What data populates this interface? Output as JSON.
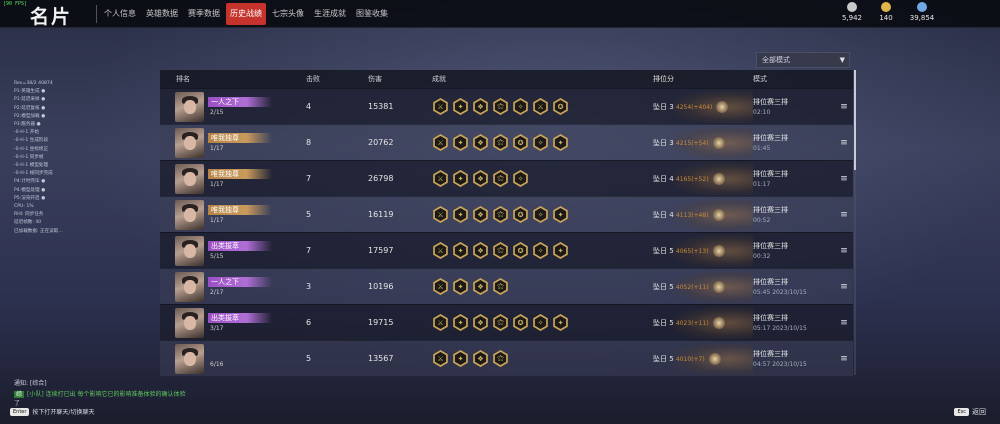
{
  "app": {
    "title": "名片",
    "fps_label": "[90 FPS]"
  },
  "tabs": [
    {
      "label": "个人信息",
      "active": false
    },
    {
      "label": "英雄数据",
      "active": false
    },
    {
      "label": "赛季数据",
      "active": false
    },
    {
      "label": "历史战绩",
      "active": true
    },
    {
      "label": "七宗头像",
      "active": false
    },
    {
      "label": "生涯成就",
      "active": false
    },
    {
      "label": "图鉴收集",
      "active": false
    }
  ],
  "currencies": [
    {
      "icon": "coin-stack-icon",
      "value": "5,942",
      "color": "#c9c9c9"
    },
    {
      "icon": "gold-ingot-icon",
      "value": "140",
      "color": "#e0b54a"
    },
    {
      "icon": "diamond-icon",
      "value": "39,854",
      "color": "#6fa8e6"
    }
  ],
  "mode_dropdown": {
    "selected": "全部模式"
  },
  "table": {
    "headers": {
      "name": "排名",
      "kills": "击败",
      "damage": "伤害",
      "achievements": "成就",
      "rank": "排位分",
      "mode": "模式"
    },
    "rows": [
      {
        "title": "一人之下",
        "title_style": "purple",
        "placement": "2/15",
        "kills": "4",
        "damage": "15381",
        "icons": [
          "⚔",
          "✦",
          "❖",
          "⚝",
          "✧",
          "⚔",
          "✪"
        ],
        "rank": "坠日 3",
        "rank_delta": "4254(+404)",
        "mode": "排位赛三排",
        "time": "02:10",
        "style": "dark"
      },
      {
        "title": "唯我独尊",
        "title_style": "gold",
        "placement": "1/17",
        "kills": "8",
        "damage": "20762",
        "icons": [
          "⚔",
          "✦",
          "❖",
          "⚝",
          "✪",
          "✧",
          "✦"
        ],
        "rank": "坠日 3",
        "rank_delta": "4215(+54)",
        "mode": "排位赛三排",
        "time": "01:45",
        "style": "light"
      },
      {
        "title": "唯我独尊",
        "title_style": "gold",
        "placement": "1/17",
        "kills": "7",
        "damage": "26798",
        "icons": [
          "⚔",
          "✦",
          "❖",
          "⚝",
          "✧"
        ],
        "rank": "坠日 4",
        "rank_delta": "4165(+52)",
        "mode": "排位赛三排",
        "time": "01:17",
        "style": "dark"
      },
      {
        "title": "唯我独尊",
        "title_style": "gold",
        "placement": "1/17",
        "kills": "5",
        "damage": "16119",
        "icons": [
          "⚔",
          "✦",
          "❖",
          "⚝",
          "✪",
          "✧",
          "✦"
        ],
        "rank": "坠日 4",
        "rank_delta": "4113(+48)",
        "mode": "排位赛三排",
        "time": "00:52",
        "style": "light"
      },
      {
        "title": "出类拔萃",
        "title_style": "purple",
        "placement": "5/15",
        "kills": "7",
        "damage": "17597",
        "icons": [
          "⚔",
          "✦",
          "❖",
          "⚝",
          "✪",
          "✧",
          "✦"
        ],
        "rank": "坠日 5",
        "rank_delta": "4065(+13)",
        "mode": "排位赛三排",
        "time": "00:32",
        "style": "dark"
      },
      {
        "title": "一人之下",
        "title_style": "purple",
        "placement": "2/17",
        "kills": "3",
        "damage": "10196",
        "icons": [
          "⚔",
          "✦",
          "❖",
          "⚝"
        ],
        "rank": "坠日 5",
        "rank_delta": "4052(+11)",
        "mode": "排位赛三排",
        "time": "05:45  2023/10/15",
        "style": "light"
      },
      {
        "title": "出类拔萃",
        "title_style": "purple",
        "placement": "3/17",
        "kills": "6",
        "damage": "19715",
        "icons": [
          "⚔",
          "✦",
          "❖",
          "⚝",
          "✪",
          "✧",
          "✦"
        ],
        "rank": "坠日 5",
        "rank_delta": "4023(+11)",
        "mode": "排位赛三排",
        "time": "05:17  2023/10/15",
        "style": "dark"
      },
      {
        "title": "",
        "title_style": "empty",
        "placement": "6/16",
        "kills": "5",
        "damage": "13567",
        "icons": [
          "⚔",
          "✦",
          "❖",
          "⚝"
        ],
        "rank": "坠日 5",
        "rank_delta": "4010(+7)",
        "mode": "排位赛三排",
        "time": "04:57  2023/10/15",
        "style": "light"
      }
    ]
  },
  "log_lines": [
    "Rev=38/2 40874",
    "P1:英雄生成 ●",
    "P1:延迟采样 ●",
    "P2:延迟复核 ●",
    "P2:模型加载 ●",
    "P3:服务器 ●",
    "-0-H-1 开始",
    "-0-H-1 生成阶段",
    "-0-H-1 坐标修正",
    "-0-H-1 同步帧",
    "-0-H-1 模型处理",
    "-0-H-1 帧同步完成",
    "P4:计时完毕 ●",
    "P4:模型处理 ●",
    "P5:渲染开启 ●",
    "CPU: 1%",
    "RHI: 同步任务",
    "延迟帧数: 40",
    "已加载数据: 正在读取..."
  ],
  "chat": {
    "title": "通知: [综合]",
    "tag": "综",
    "message": "[小队] 连续打已出 每个影响它已的影响准备体验的确认体验",
    "message2": "了"
  },
  "hints": {
    "enter_key": "Enter",
    "enter_text": "按下打开聊天/切换聊天",
    "esc_key": "Esc",
    "esc_text": "返回"
  }
}
